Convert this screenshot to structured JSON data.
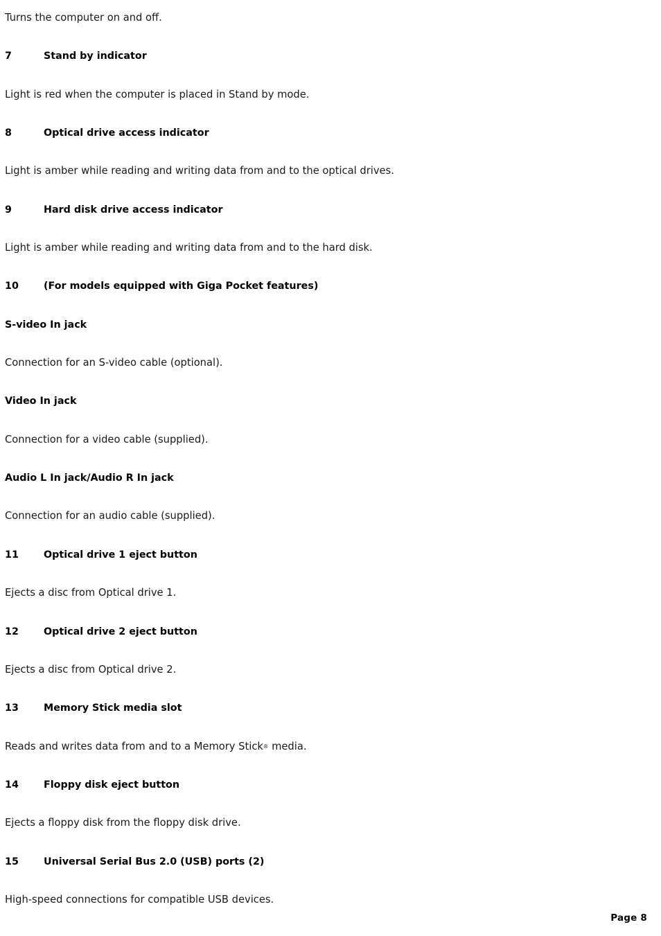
{
  "page": {
    "footer_label": "Page 8",
    "background_color": "#ffffff",
    "text_color": "#1a1a1a"
  },
  "blocks": [
    {
      "kind": "paragraph",
      "text": "Turns the computer on and off."
    },
    {
      "kind": "numbered-heading",
      "number": "7",
      "text": "Stand by indicator"
    },
    {
      "kind": "paragraph",
      "text": "Light is red when the computer is placed in Stand by mode."
    },
    {
      "kind": "numbered-heading",
      "number": "8",
      "text": "Optical drive access indicator"
    },
    {
      "kind": "paragraph",
      "text": "Light is amber while reading and writing data from and to the optical drives."
    },
    {
      "kind": "numbered-heading",
      "number": "9",
      "text": "Hard disk drive access indicator"
    },
    {
      "kind": "paragraph",
      "text": "Light is amber while reading and writing data from and to the hard disk."
    },
    {
      "kind": "numbered-heading",
      "number": "10",
      "text": "(For models equipped with Giga Pocket features)"
    },
    {
      "kind": "subheading",
      "text": "S-video In jack"
    },
    {
      "kind": "paragraph",
      "text": "Connection for an S-video cable (optional)."
    },
    {
      "kind": "subheading",
      "text": "Video In jack"
    },
    {
      "kind": "paragraph",
      "text": "Connection for a video cable (supplied)."
    },
    {
      "kind": "subheading",
      "text": "Audio L In jack/Audio R In jack"
    },
    {
      "kind": "paragraph",
      "text": "Connection for an audio cable (supplied)."
    },
    {
      "kind": "numbered-heading",
      "number": "11",
      "text": "Optical drive 1 eject button"
    },
    {
      "kind": "paragraph",
      "text": "Ejects a disc from Optical drive 1."
    },
    {
      "kind": "numbered-heading",
      "number": "12",
      "text": "Optical drive 2 eject button"
    },
    {
      "kind": "paragraph",
      "text": "Ejects a disc from Optical drive 2."
    },
    {
      "kind": "numbered-heading",
      "number": "13",
      "text": "Memory Stick media slot"
    },
    {
      "kind": "paragraph-trademark",
      "text_before": "Reads and writes data from and to a Memory Stick",
      "symbol": "®",
      "text_after": " media."
    },
    {
      "kind": "numbered-heading",
      "number": "14",
      "text": "Floppy disk eject button"
    },
    {
      "kind": "paragraph",
      "text": "Ejects a floppy disk from the floppy disk drive."
    },
    {
      "kind": "numbered-heading",
      "number": "15",
      "text": "Universal Serial Bus 2.0 (USB) ports (2)"
    },
    {
      "kind": "paragraph",
      "text": "High-speed connections for compatible USB devices."
    }
  ]
}
